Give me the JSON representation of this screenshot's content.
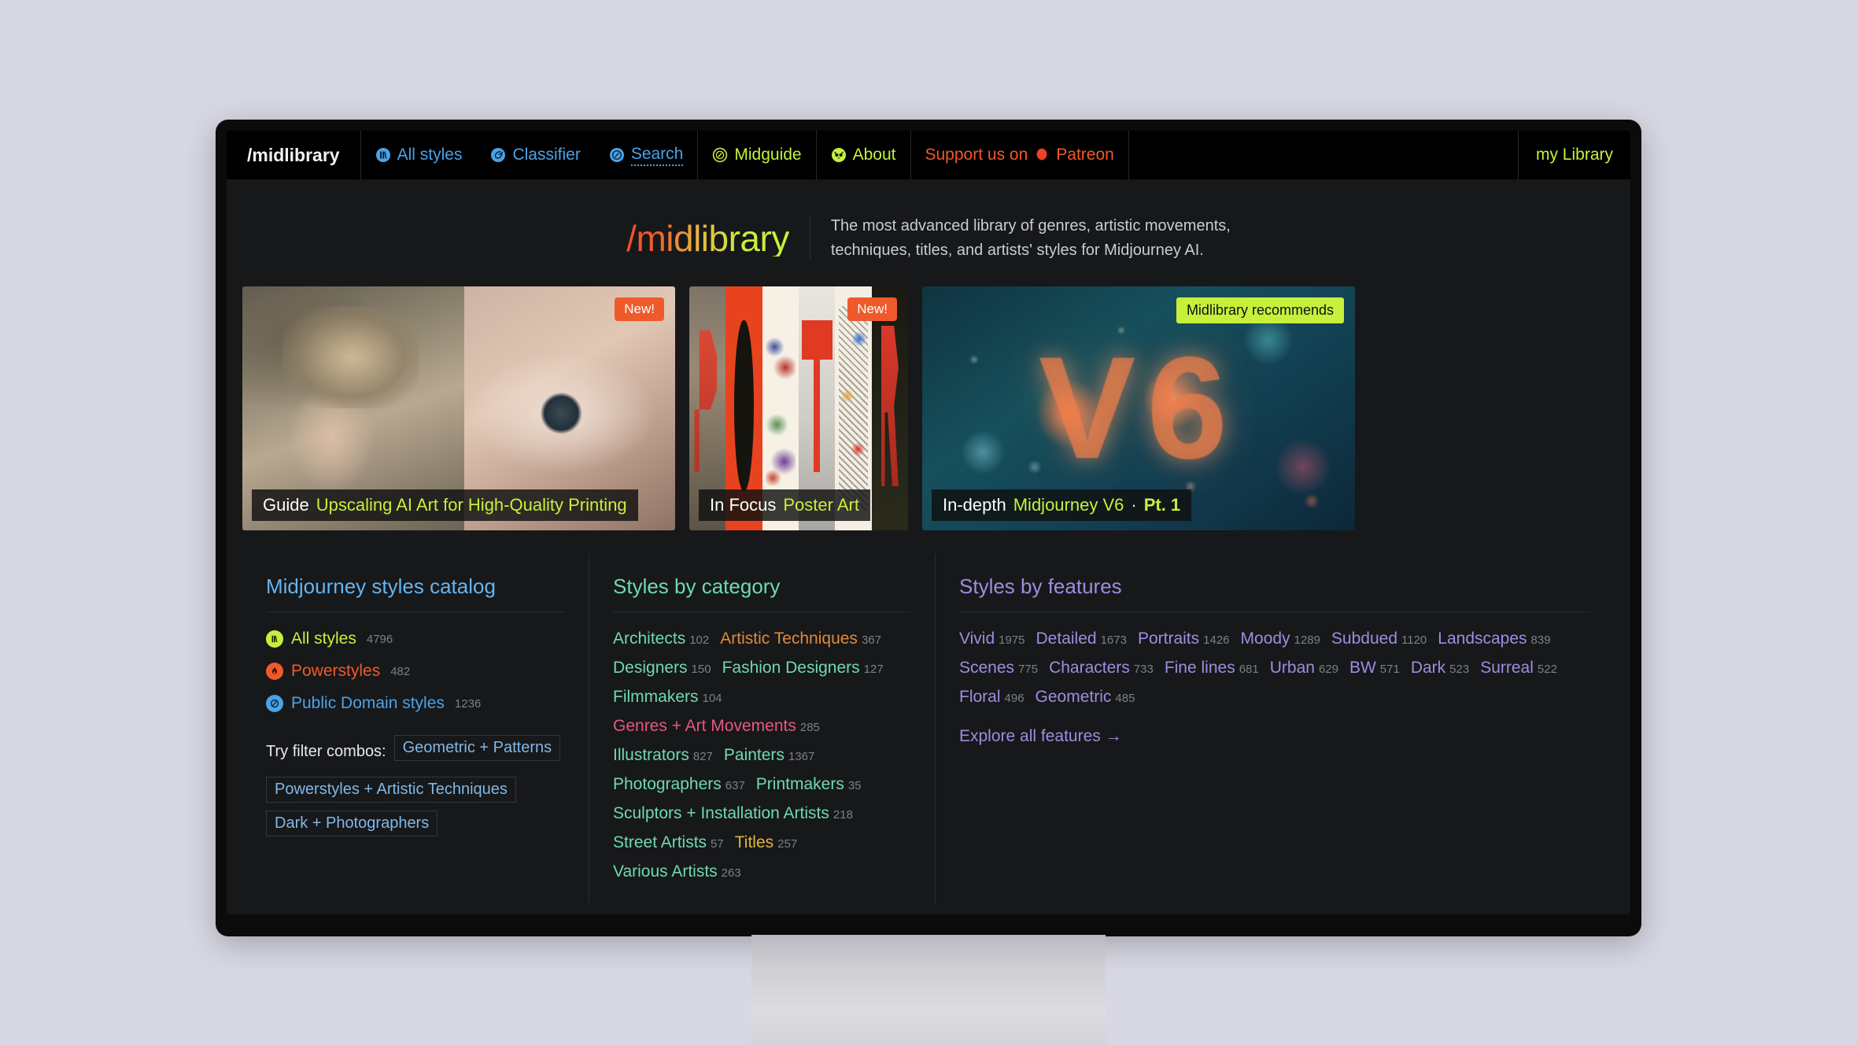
{
  "nav": {
    "brand": "/midlibrary",
    "items": [
      {
        "label": "All styles",
        "icon": "library-icon",
        "color": "blue"
      },
      {
        "label": "Classifier",
        "icon": "classifier-icon",
        "color": "blue"
      },
      {
        "label": "Search",
        "icon": "search-compass-icon",
        "color": "blue"
      },
      {
        "label": "Midguide",
        "icon": "compass-icon",
        "color": "green"
      },
      {
        "label": "About",
        "icon": "owl-icon",
        "color": "green"
      }
    ],
    "support_prefix": "Support us on",
    "support_brand": "Patreon",
    "my_library": "my Library"
  },
  "hero": {
    "logo_slash": "/",
    "logo_mid": "mid",
    "logo_library": "library",
    "tagline_line1": "The most advanced library of genres, artistic movements,",
    "tagline_line2": "techniques, titles, and artists' styles for Midjourney AI."
  },
  "cards": [
    {
      "badge": "New!",
      "badge_type": "new",
      "caption_prefix": "Guide",
      "caption_main": "Upscaling AI Art for High-Quality Printing",
      "art": "elf-portrait-and-eye"
    },
    {
      "badge": "New!",
      "badge_type": "new",
      "caption_prefix": "In Focus",
      "caption_main": "Poster Art",
      "art": "poster-letters"
    },
    {
      "badge": "Midlibrary recommends",
      "badge_type": "recommend",
      "caption_prefix": "In-depth",
      "caption_main": "Midjourney V6",
      "caption_sep": "·",
      "caption_part": "Pt. 1",
      "art": "v6-coral",
      "art_text": "V6"
    }
  ],
  "catalog": {
    "title": "Midjourney styles catalog",
    "entries": [
      {
        "label": "All styles",
        "count": "4796",
        "color": "#c6f03c",
        "icon": "library-badge-icon"
      },
      {
        "label": "Powerstyles",
        "count": "482",
        "color": "#ef5a2b",
        "icon": "flame-badge-icon"
      },
      {
        "label": "Public Domain styles",
        "count": "1236",
        "color": "#4aa3e8",
        "icon": "public-domain-badge-icon"
      }
    ],
    "combos_label": "Try filter combos:",
    "combos": [
      "Geometric + Patterns",
      "Powerstyles + Artistic Techniques",
      "Dark + Photographers"
    ]
  },
  "by_category": {
    "title": "Styles by category",
    "items": [
      {
        "label": "Architects",
        "count": "102",
        "tone": "mint"
      },
      {
        "label": "Artistic Techniques",
        "count": "367",
        "tone": "orange"
      },
      {
        "label": "Designers",
        "count": "150",
        "tone": "mint"
      },
      {
        "label": "Fashion Designers",
        "count": "127",
        "tone": "mint"
      },
      {
        "label": "Filmmakers",
        "count": "104",
        "tone": "mint"
      },
      {
        "label": "Genres + Art Movements",
        "count": "285",
        "tone": "pink"
      },
      {
        "label": "Illustrators",
        "count": "827",
        "tone": "mint"
      },
      {
        "label": "Painters",
        "count": "1367",
        "tone": "mint"
      },
      {
        "label": "Photographers",
        "count": "637",
        "tone": "mint"
      },
      {
        "label": "Printmakers",
        "count": "35",
        "tone": "mint"
      },
      {
        "label": "Sculptors + Installation Artists",
        "count": "218",
        "tone": "mint"
      },
      {
        "label": "Street Artists",
        "count": "57",
        "tone": "mint"
      },
      {
        "label": "Titles",
        "count": "257",
        "tone": "gold"
      },
      {
        "label": "Various Artists",
        "count": "263",
        "tone": "mint"
      }
    ]
  },
  "by_features": {
    "title": "Styles by features",
    "items": [
      {
        "label": "Vivid",
        "count": "1975"
      },
      {
        "label": "Detailed",
        "count": "1673"
      },
      {
        "label": "Portraits",
        "count": "1426"
      },
      {
        "label": "Moody",
        "count": "1289"
      },
      {
        "label": "Subdued",
        "count": "1120"
      },
      {
        "label": "Landscapes",
        "count": "839"
      },
      {
        "label": "Scenes",
        "count": "775"
      },
      {
        "label": "Characters",
        "count": "733"
      },
      {
        "label": "Fine lines",
        "count": "681"
      },
      {
        "label": "Urban",
        "count": "629"
      },
      {
        "label": "BW",
        "count": "571"
      },
      {
        "label": "Dark",
        "count": "523"
      },
      {
        "label": "Surreal",
        "count": "522"
      },
      {
        "label": "Floral",
        "count": "496"
      },
      {
        "label": "Geometric",
        "count": "485"
      }
    ],
    "explore": "Explore all features →"
  },
  "colors": {
    "accent_green": "#c6f03c",
    "accent_blue": "#4aa3e8",
    "accent_orange": "#ef5a2b",
    "mint": "#6fd9b0",
    "purple": "#9b8fe0"
  }
}
